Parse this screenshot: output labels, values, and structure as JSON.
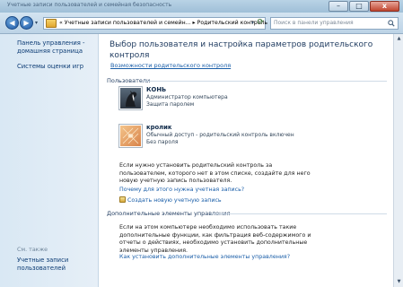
{
  "titlebar": {
    "text": "Учетные записи пользователей и семейная безопасность",
    "minimize_label": "–",
    "maximize_label": "□",
    "close_label": "x"
  },
  "nav": {
    "back_label": "◀",
    "forward_label": "▶",
    "dropdown_label": "▾",
    "address_text": "« Учетные записи пользователей и семейн... ▸ Родительский контроль",
    "address_dropdown": "▾",
    "refresh_label": "⟳",
    "search_placeholder": "Поиск в панели управления"
  },
  "sidebar": {
    "home_link": "Панель управления - домашняя страница",
    "ratings_link": "Системы оценки игр",
    "see_also": "См. также",
    "accounts_link": "Учетные записи пользователей"
  },
  "main": {
    "heading": "Выбор пользователя и настройка параметров родительского контроля",
    "parental_link": "Возможности родительского контроля",
    "users_section": "Пользователи",
    "users": [
      {
        "name": "КОНЬ",
        "line1": "Администратор компьютера",
        "line2": "Защита паролем",
        "icon": "horse-icon"
      },
      {
        "name": "кролик",
        "line1": "Обычный доступ - родительский контроль включен",
        "line2": "Без пароля",
        "icon": "rabbit-icon"
      }
    ],
    "note": "Если нужно установить родительский контроль за пользователем, которого нет в этом списке, создайте для него новую учетную запись пользователя.",
    "why_link": "Почему для этого нужна учетная запись?",
    "create_link": "Создать новую учетную запись",
    "extra_section": "Дополнительные элементы управления",
    "note2": "Если на этом компьютере необходимо использовать такие дополнительные функции, как фильтрация веб-содержимого и отчеты о действиях, необходимо установить дополнительные элементы управления.",
    "how_link": "Как установить дополнительные элементы управления?"
  },
  "colors": {
    "link": "#1a5ea8",
    "sidebar_bg": "#d9e8f4",
    "heading": "#1e3a5f"
  }
}
